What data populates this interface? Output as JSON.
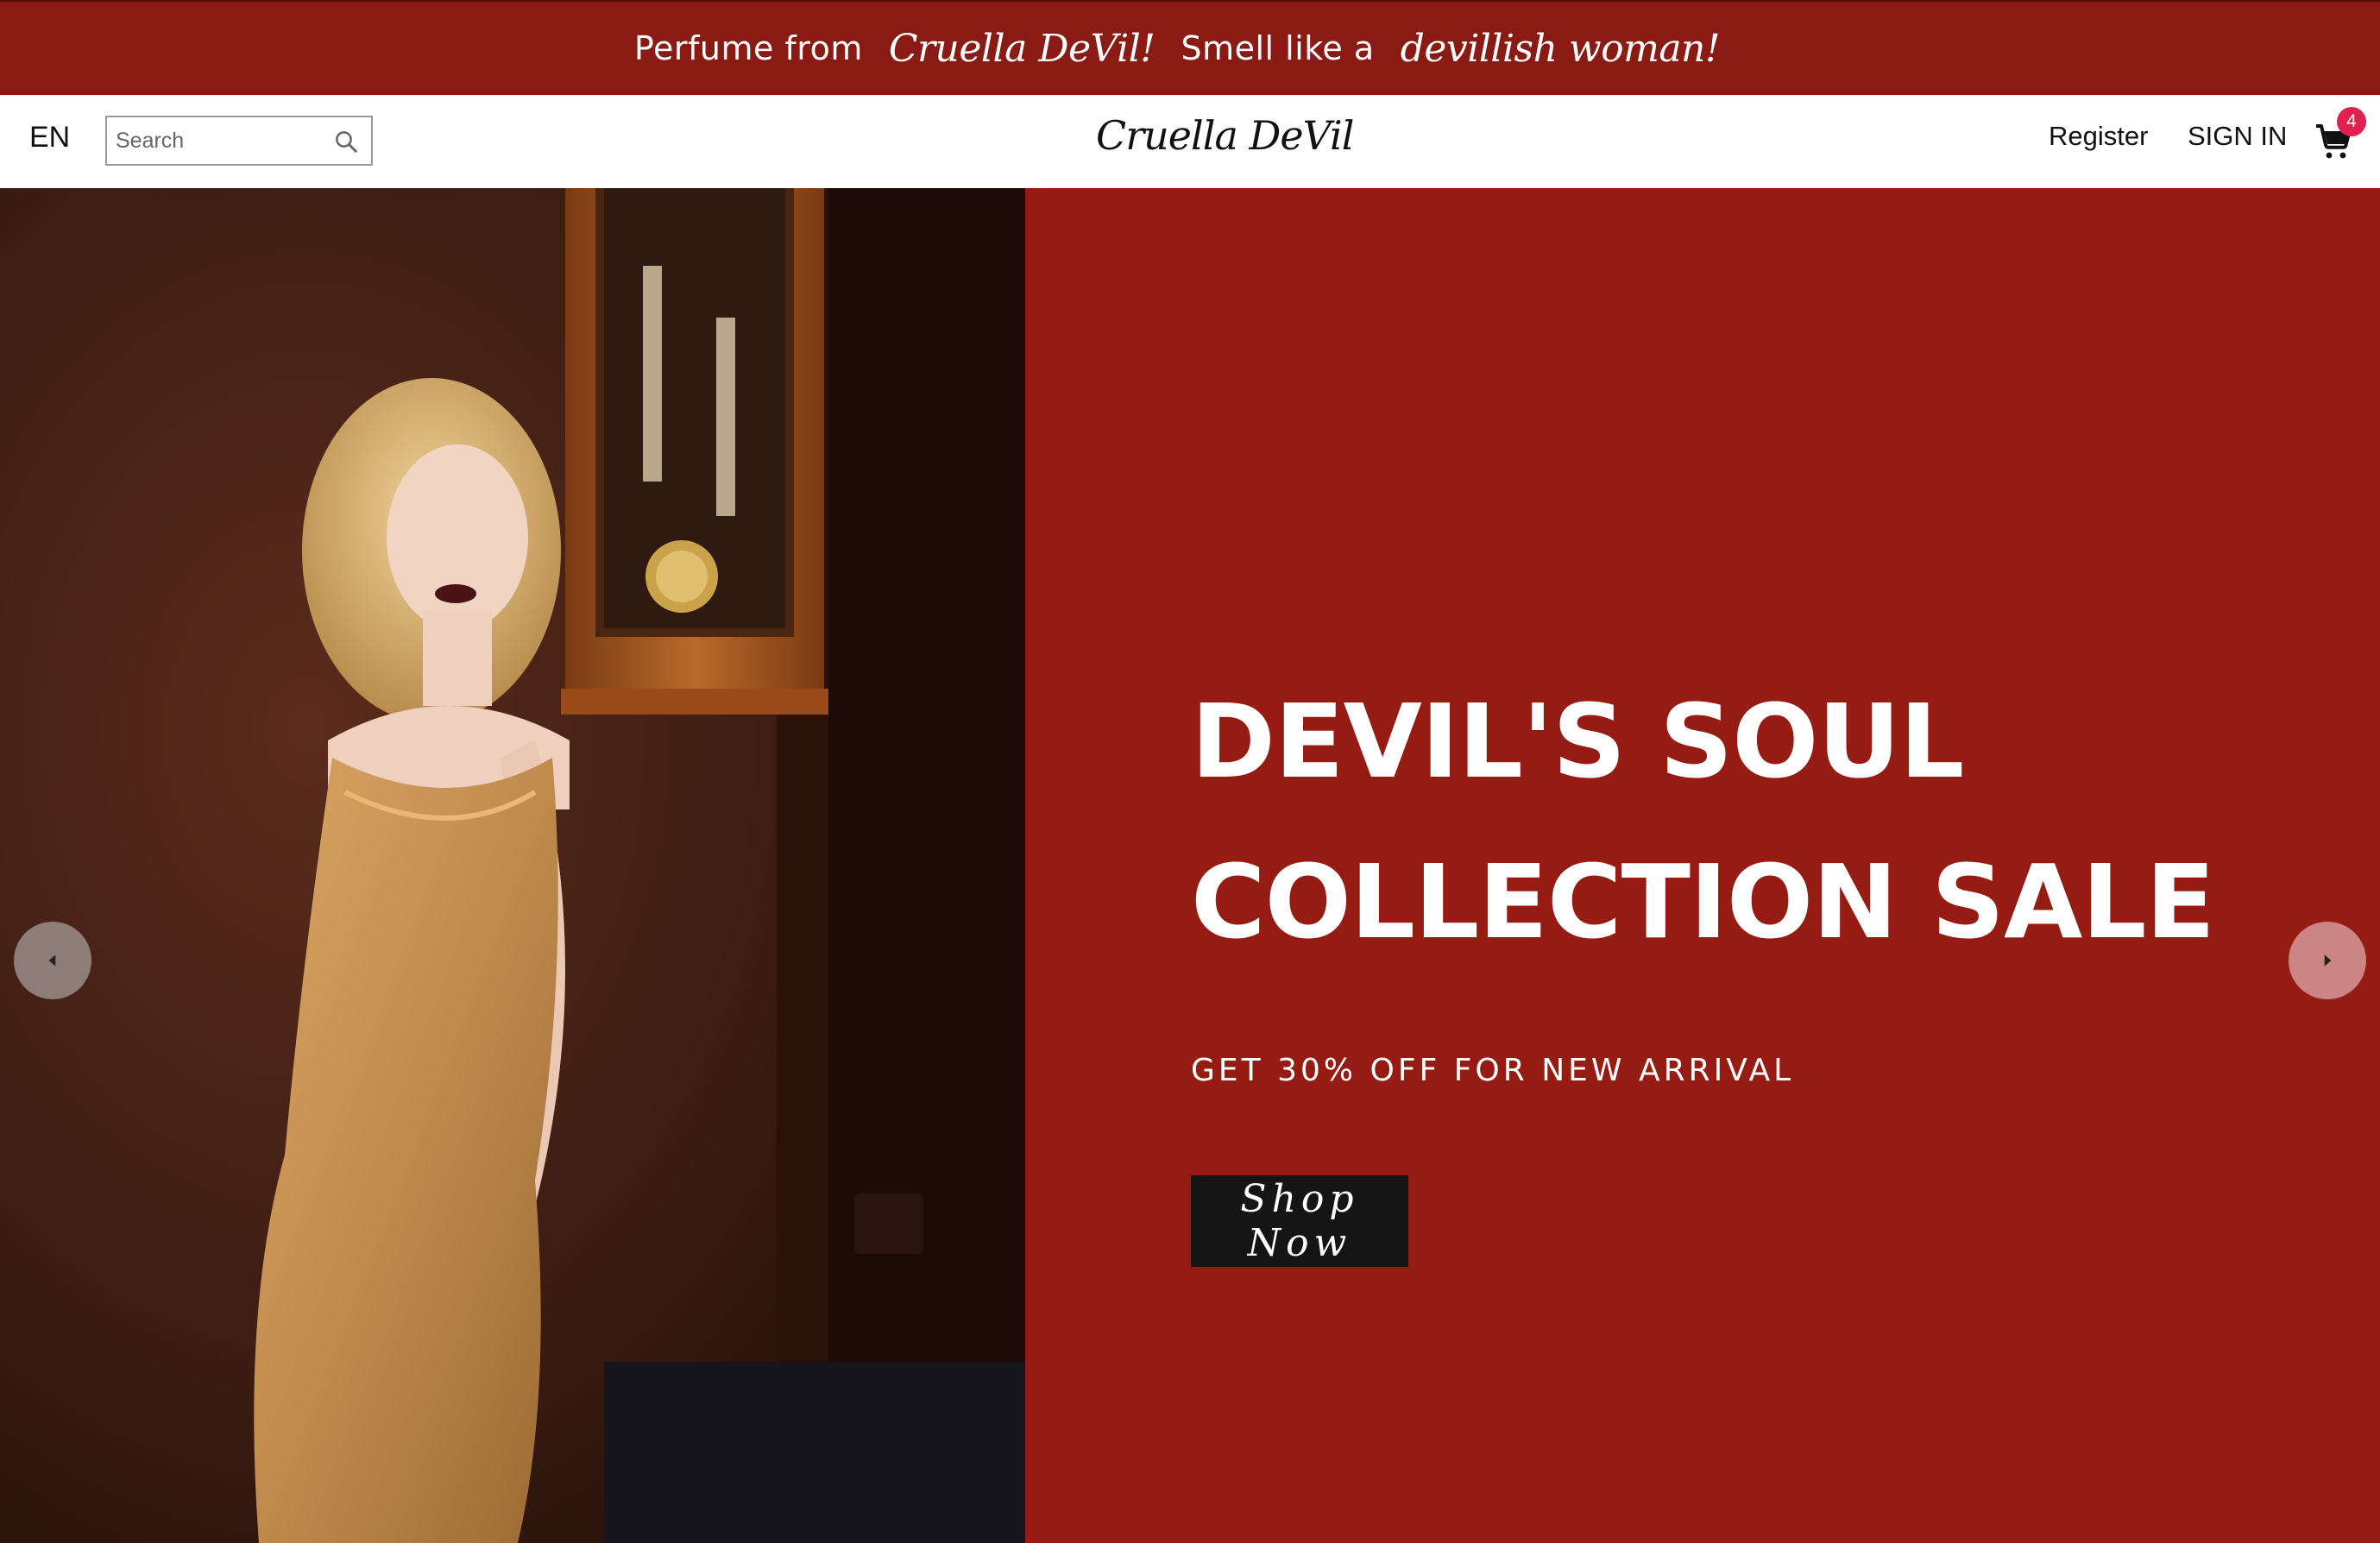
{
  "announcement": {
    "part1": "Perfume from",
    "brand": "Cruella DeVil!",
    "part2": "Smell like a",
    "tagline": "devillish woman!"
  },
  "nav": {
    "language": "EN",
    "search": {
      "placeholder": "Search",
      "value": ""
    },
    "logo": "Cruella DeVil",
    "register_label": "Register",
    "signin_label": "SIGN IN",
    "cart_count": "4"
  },
  "hero": {
    "title_line1": "DEVIL'S SOUL",
    "title_line2": "COLLECTION SALE",
    "subtitle": "GET 30% OFF FOR NEW ARRIVAL",
    "cta_label": "Shop Now",
    "image_alt": "woman in gold sequin gown beside pendulum clock",
    "panel_color": "#961c13"
  },
  "colors": {
    "announcement_bg": "#8a1a14",
    "badge": "#e2204e",
    "button_bg": "#151515"
  },
  "icons": {
    "search": "search-icon",
    "cart": "cart-icon",
    "prev": "chevron-left-icon",
    "next": "chevron-right-icon"
  }
}
